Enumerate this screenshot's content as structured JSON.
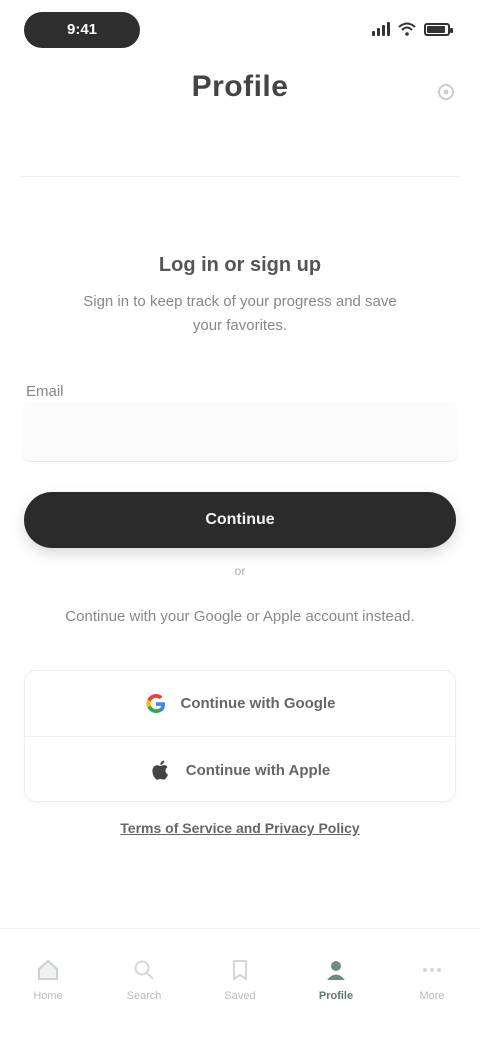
{
  "status_bar": {
    "time": "9:41",
    "signal_bars": 4,
    "battery_level": 0.8
  },
  "header": {
    "title": "Profile",
    "left_text": "",
    "note": ""
  },
  "signin": {
    "heading": "Log in or sign up",
    "description": "Sign in to keep track of your progress and save your favorites.",
    "email_label": "Email",
    "email_placeholder": "",
    "email_value": "",
    "continue_label": "Continue",
    "or_text": "or",
    "alt_description": "Continue with your Google or Apple account instead.",
    "providers": [
      {
        "label": "Continue with Google",
        "icon": "google-icon"
      },
      {
        "label": "Continue with Apple",
        "icon": "apple-icon"
      }
    ],
    "terms_text": "Terms of Service and Privacy Policy"
  },
  "bottom_nav": {
    "items": [
      {
        "label": "Home",
        "icon": "home-icon",
        "active": false
      },
      {
        "label": "Search",
        "icon": "search-icon",
        "active": false
      },
      {
        "label": "Saved",
        "icon": "bookmark-icon",
        "active": false
      },
      {
        "label": "Profile",
        "icon": "profile-icon",
        "active": true
      },
      {
        "label": "More",
        "icon": "more-icon",
        "active": false
      }
    ]
  },
  "colors": {
    "primary_button": "#2b2b2b",
    "active_nav": "#5a7a6e",
    "text_muted": "#888888"
  }
}
